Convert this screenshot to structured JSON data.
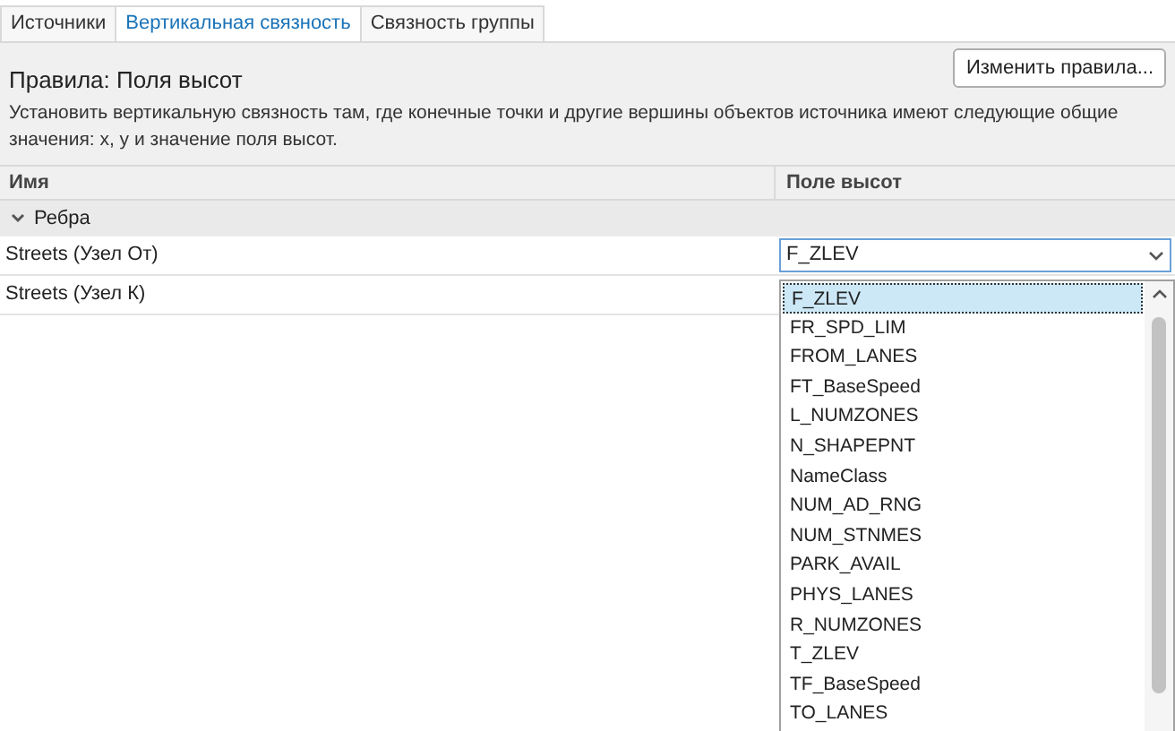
{
  "tabs": [
    {
      "label": "Источники",
      "selected": false
    },
    {
      "label": "Вертикальная связность",
      "selected": true
    },
    {
      "label": "Связность группы",
      "selected": false
    }
  ],
  "rules_title": "Правила: Поля высот",
  "edit_button": "Изменить правила...",
  "description": "Установить вертикальную связность там, где конечные точки и другие вершины объектов источника имеют следующие общие значения: x, y и значение поля высот.",
  "table": {
    "columns": [
      "Имя",
      "Поле высот"
    ],
    "group": {
      "label": "Ребра",
      "expanded": true
    },
    "rows": [
      {
        "name": "Streets (Узел От)",
        "value": "F_ZLEV"
      },
      {
        "name": "Streets (Узел К)"
      }
    ]
  },
  "dropdown": {
    "items": [
      {
        "label": "F_ZLEV",
        "selected": true
      },
      {
        "label": "FR_SPD_LIM",
        "selected": false
      },
      {
        "label": "FROM_LANES",
        "selected": false
      },
      {
        "label": "FT_BaseSpeed",
        "selected": false
      },
      {
        "label": "L_NUMZONES",
        "selected": false
      },
      {
        "label": "N_SHAPEPNT",
        "selected": false
      },
      {
        "label": "NameClass",
        "selected": false
      },
      {
        "label": "NUM_AD_RNG",
        "selected": false
      },
      {
        "label": "NUM_STNMES",
        "selected": false
      },
      {
        "label": "PARK_AVAIL",
        "selected": false
      },
      {
        "label": "PHYS_LANES",
        "selected": false
      },
      {
        "label": "R_NUMZONES",
        "selected": false
      },
      {
        "label": "T_ZLEV",
        "selected": false
      },
      {
        "label": "TF_BaseSpeed",
        "selected": false
      },
      {
        "label": "TO_LANES",
        "selected": false
      }
    ]
  }
}
